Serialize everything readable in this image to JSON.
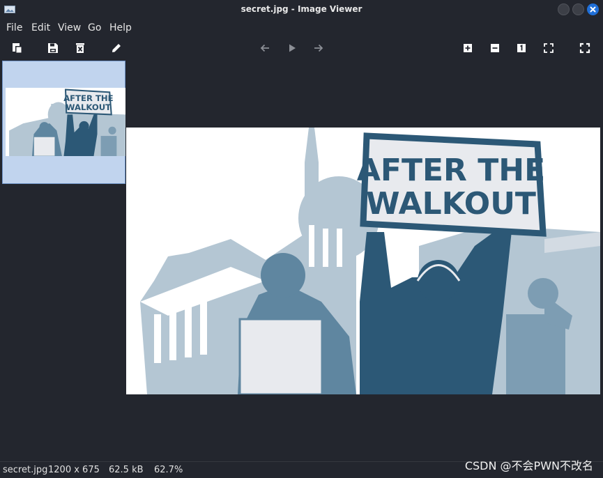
{
  "window": {
    "title": "secret.jpg - Image Viewer"
  },
  "menu": [
    "File",
    "Edit",
    "View",
    "Go",
    "Help"
  ],
  "toolbar": {
    "left": [
      "copy-icon",
      "save-icon",
      "delete-icon",
      "edit-icon"
    ],
    "nav": [
      "back-arrow-icon",
      "play-icon",
      "forward-arrow-icon"
    ],
    "right": [
      "zoom-in-icon",
      "zoom-out-icon",
      "actual-size-icon",
      "fit-icon",
      "fullscreen-icon"
    ]
  },
  "image": {
    "sign_line1": "AFTER THE",
    "sign_line2": "WALKOUT"
  },
  "status": {
    "filename": "secret.jpg",
    "dimensions": "1200 x 675",
    "filesize": "62.5 kB",
    "zoom": "62.7%"
  },
  "watermark": "CSDN @不会PWN不改名",
  "colors": {
    "background": "#23262e",
    "accent": "#1f6fd8",
    "thumb_bg": "#c1d4ee",
    "dark_blue": "#2c5876",
    "mid_blue": "#5f86a0",
    "light_blue": "#b4c6d3"
  }
}
